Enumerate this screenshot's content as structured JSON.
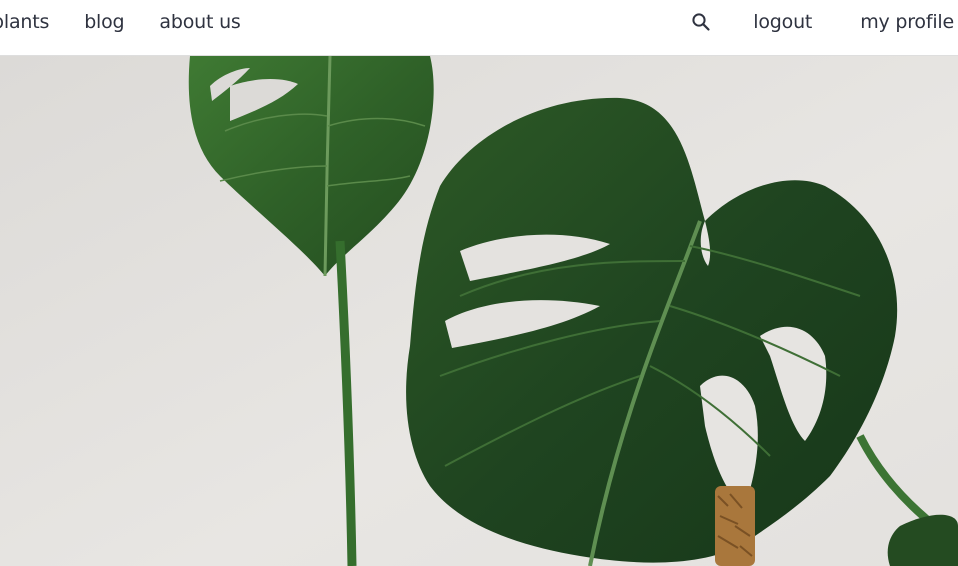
{
  "nav": {
    "left_links": [
      "plants",
      "blog",
      "about us"
    ],
    "search_icon": "search-icon",
    "logout_label": "logout",
    "profile_label": "my profile"
  },
  "hero": {
    "background_color": "#e6e4e1",
    "leaf_color": "#2b5a26"
  }
}
